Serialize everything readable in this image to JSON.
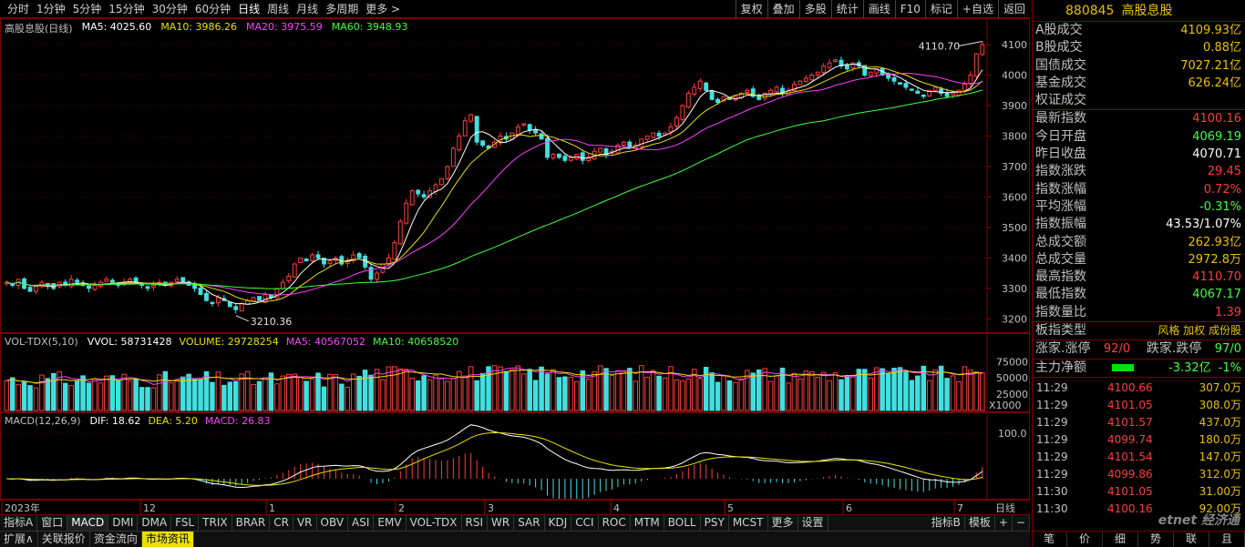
{
  "toolbar": {
    "periods": [
      "分时",
      "1分钟",
      "5分钟",
      "15分钟",
      "30分钟",
      "60分钟",
      "日线",
      "周线",
      "月线",
      "多周期",
      "更多 >"
    ],
    "active_period": "日线",
    "tools": [
      "复权",
      "叠加",
      "多股",
      "统计",
      "画线",
      "F10",
      "标记",
      "+自选",
      "返回"
    ]
  },
  "main_chart": {
    "title": "高股息股(日线)",
    "ma": [
      {
        "label": "MA5: 4025.60",
        "color": "#ffffff"
      },
      {
        "label": "MA10: 3986.26",
        "color": "#e8e000"
      },
      {
        "label": "MA20: 3975.59",
        "color": "#ff40ff"
      },
      {
        "label": "MA60: 3948.93",
        "color": "#40ff40"
      }
    ],
    "high_label": "4110.70",
    "low_label": "3210.36",
    "y_ticks": [
      "4100",
      "4000",
      "3900",
      "3800",
      "3700",
      "3600",
      "3500",
      "3400",
      "3300",
      "3200"
    ]
  },
  "volume_chart": {
    "title": "VOL-TDX(5,10)",
    "items": [
      {
        "label": "VVOL: 58731428",
        "color": "#ffffff"
      },
      {
        "label": "VOLUME: 29728254",
        "color": "#e8e000"
      },
      {
        "label": "MA5: 40567052",
        "color": "#ff40ff"
      },
      {
        "label": "MA10: 40658520",
        "color": "#40ff40"
      }
    ],
    "y_ticks": [
      "75000",
      "50000",
      "25000"
    ],
    "unit": "X1000"
  },
  "macd_chart": {
    "title": "MACD(12,26,9)",
    "items": [
      {
        "label": "DIF: 18.62",
        "color": "#ffffff"
      },
      {
        "label": "DEA: 5.20",
        "color": "#e8e000"
      },
      {
        "label": "MACD: 26.83",
        "color": "#ff40ff"
      }
    ],
    "y_ticks": [
      "100.0"
    ]
  },
  "x_axis": {
    "labels": [
      "2023年",
      "12",
      "1",
      "2",
      "3",
      "4",
      "5",
      "6",
      "7"
    ],
    "mode": "日线"
  },
  "chart_data": {
    "type": "candlestick",
    "title": "高股息股(日线)",
    "ylim": [
      3180,
      4130
    ],
    "y_ticks": [
      3200,
      3300,
      3400,
      3500,
      3600,
      3700,
      3800,
      3900,
      4000,
      4100
    ],
    "x_labels": [
      "2023年",
      "12",
      "1",
      "2",
      "3",
      "4",
      "5",
      "6",
      "7"
    ],
    "close": [
      3320,
      3310,
      3330,
      3300,
      3290,
      3310,
      3320,
      3310,
      3300,
      3320,
      3310,
      3330,
      3320,
      3310,
      3300,
      3310,
      3320,
      3330,
      3320,
      3310,
      3320,
      3330,
      3320,
      3310,
      3300,
      3310,
      3320,
      3310,
      3320,
      3330,
      3320,
      3310,
      3300,
      3280,
      3260,
      3250,
      3270,
      3260,
      3240,
      3230,
      3250,
      3260,
      3270,
      3260,
      3280,
      3270,
      3300,
      3320,
      3340,
      3380,
      3400,
      3390,
      3410,
      3400,
      3380,
      3390,
      3400,
      3380,
      3390,
      3410,
      3400,
      3370,
      3330,
      3350,
      3380,
      3400,
      3450,
      3520,
      3580,
      3620,
      3610,
      3600,
      3620,
      3640,
      3660,
      3700,
      3760,
      3800,
      3850,
      3870,
      3780,
      3770,
      3760,
      3780,
      3800,
      3790,
      3810,
      3830,
      3840,
      3820,
      3810,
      3790,
      3730,
      3740,
      3730,
      3720,
      3730,
      3740,
      3720,
      3730,
      3750,
      3760,
      3740,
      3750,
      3770,
      3780,
      3760,
      3770,
      3790,
      3800,
      3810,
      3800,
      3810,
      3830,
      3860,
      3900,
      3940,
      3960,
      3980,
      3950,
      3920,
      3910,
      3930,
      3920,
      3930,
      3940,
      3950,
      3930,
      3920,
      3940,
      3950,
      3960,
      3940,
      3950,
      3970,
      3980,
      3990,
      4000,
      4010,
      4030,
      4040,
      4050,
      4030,
      4020,
      4040,
      4030,
      4000,
      4010,
      4020,
      4000,
      3990,
      3980,
      3970,
      3960,
      3950,
      3940,
      3930,
      3950,
      3960,
      3940,
      3930,
      3940,
      3950,
      3970,
      4000,
      4070,
      4100
    ],
    "ma5_last": 4025.6,
    "ma10_last": 3986.26,
    "ma20_last": 3975.59,
    "ma60_last": 3948.93,
    "high": 4110.7,
    "low": 3210.36,
    "volume_ylim": [
      0,
      95000
    ],
    "volume_ticks": [
      25000,
      50000,
      75000
    ],
    "macd_ticks": [
      100.0
    ]
  },
  "quote": {
    "code": "880845",
    "name": "高股息股",
    "rows1": [
      {
        "label": "A股成交",
        "value": "4109.93亿",
        "color": "#e8c000"
      },
      {
        "label": "B股成交",
        "value": "0.88亿",
        "color": "#e8c000"
      },
      {
        "label": "国债成交",
        "value": "7027.21亿",
        "color": "#e8c000"
      },
      {
        "label": "基金成交",
        "value": "626.24亿",
        "color": "#e8c000"
      },
      {
        "label": "权证成交",
        "value": "",
        "color": "#e8c000"
      }
    ],
    "rows2": [
      {
        "label": "最新指数",
        "value": "4100.16",
        "color": "#ff3c3c"
      },
      {
        "label": "今日开盘",
        "value": "4069.19",
        "color": "#40ff40"
      },
      {
        "label": "昨日收盘",
        "value": "4070.71",
        "color": "#ffffff"
      },
      {
        "label": "指数涨跌",
        "value": "29.45",
        "color": "#ff3c3c"
      },
      {
        "label": "指数涨幅",
        "value": "0.72%",
        "color": "#ff3c3c"
      },
      {
        "label": "平均涨幅",
        "value": "-0.31%",
        "color": "#40ff40"
      },
      {
        "label": "指数振幅",
        "value": "43.53/1.07%",
        "color": "#ffffff"
      },
      {
        "label": "总成交额",
        "value": "262.93亿",
        "color": "#e8c000"
      },
      {
        "label": "总成交量",
        "value": "2972.8万",
        "color": "#e8c000"
      },
      {
        "label": "最高指数",
        "value": "4110.70",
        "color": "#ff3c3c"
      },
      {
        "label": "最低指数",
        "value": "4067.17",
        "color": "#40ff40"
      },
      {
        "label": "指数量比",
        "value": "1.39",
        "color": "#ff3c3c"
      }
    ],
    "board_type_label": "板指类型",
    "board_type_value": "风格 加权 成份股",
    "up_label": "涨家.涨停",
    "up_value": "92/0",
    "down_label": "跌家.跌停",
    "down_value": "97/0",
    "capital_label": "主力净额",
    "capital_value": "-3.32亿",
    "capital_pct": "-1%",
    "ticks": [
      {
        "time": "11:29",
        "price": "4100.66",
        "vol": "307.0万"
      },
      {
        "time": "11:29",
        "price": "4101.05",
        "vol": "308.0万"
      },
      {
        "time": "11:29",
        "price": "4101.57",
        "vol": "437.0万"
      },
      {
        "time": "11:29",
        "price": "4099.74",
        "vol": "180.0万"
      },
      {
        "time": "11:29",
        "price": "4101.54",
        "vol": "147.0万"
      },
      {
        "time": "11:29",
        "price": "4099.86",
        "vol": "312.0万"
      },
      {
        "time": "11:30",
        "price": "4101.05",
        "vol": "31.00万"
      },
      {
        "time": "11:30",
        "price": "4100.16",
        "vol": "92.00万"
      }
    ]
  },
  "indicator_tabs": [
    "指标A",
    "窗口",
    "MACD",
    "DMI",
    "DMA",
    "FSL",
    "TRIX",
    "BRAR",
    "CR",
    "VR",
    "OBV",
    "ASI",
    "EMV",
    "VOL-TDX",
    "RSI",
    "WR",
    "SAR",
    "KDJ",
    "CCI",
    "ROC",
    "MTM",
    "BOLL",
    "PSY",
    "MCST",
    "更多",
    "设置"
  ],
  "indicator_right": [
    "指标B",
    "模板",
    "+",
    "−"
  ],
  "ext_tabs": [
    "扩展∧",
    "关联报价",
    "资金流向",
    "市场资讯"
  ],
  "right_tabs": [
    "笔",
    "价",
    "细",
    "势",
    "联",
    "且"
  ],
  "watermark": "etnet 经济通"
}
